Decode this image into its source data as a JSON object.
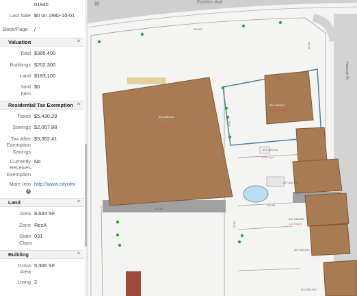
{
  "panel": {
    "zip": "01940",
    "rows_top": [
      {
        "label": "Last Sale",
        "value": "$0 on 1982-10-01"
      },
      {
        "label": "Book/Page",
        "value": "/"
      }
    ],
    "valuation": {
      "title": "Valuation",
      "rows": [
        {
          "label": "Total",
          "value": "$385,400"
        },
        {
          "label": "Buildings",
          "value": "$202,300"
        },
        {
          "label": "Land",
          "value": "$183,100"
        },
        {
          "label": "Yard Item",
          "value": "$0"
        }
      ]
    },
    "exemption": {
      "title": "Residential Tax Exemption",
      "rows": [
        {
          "label": "Taxes",
          "value": "$5,430.29"
        },
        {
          "label": "Savings",
          "value": "$2,067.88"
        },
        {
          "label": "Tax After Exemption Savings",
          "value": "$3,362.41"
        },
        {
          "label": "Currently Receives Exemption",
          "value": "No"
        },
        {
          "label": "More Info",
          "value": "http://www.cityofm"
        }
      ]
    },
    "land": {
      "title": "Land",
      "rows": [
        {
          "label": "Area",
          "value": "8,634 SF"
        },
        {
          "label": "Zone",
          "value": "ResA"
        },
        {
          "label": "State Class",
          "value": "031"
        }
      ]
    },
    "building": {
      "title": "Building",
      "rows": [
        {
          "label": "Gross Area",
          "value": "5,306 SF"
        },
        {
          "label": "Living",
          "value": "2"
        }
      ]
    },
    "chevron": "^"
  },
  "map": {
    "street_top": "Eastern Ave",
    "street_right": "Hancock St",
    "large_building": {
      "id": "027-430-046",
      "area": "4,916 sq ft"
    },
    "selected_building": {
      "id": "027-430-047",
      "area": "1,534 sq ft"
    },
    "buildings": [
      {
        "id": "027-430-048",
        "area": "1,031 sq ft"
      },
      {
        "id": "027-430-049",
        "area": ""
      },
      {
        "id": "027-430-050",
        "area": "1,178 sq ft"
      },
      {
        "id": "027-430-051",
        "area": ""
      },
      {
        "id": "027-430-052",
        "area": ""
      }
    ],
    "dims": [
      "229.84",
      "106.8",
      "41.8",
      "250.36",
      "130.36",
      "40.35",
      "60.15"
    ],
    "colors": {
      "building": "#a87b52",
      "selection": "#4e7fa0",
      "tree": "#2aa82a"
    }
  }
}
